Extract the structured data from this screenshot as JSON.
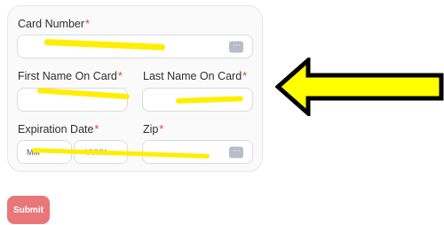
{
  "form": {
    "card_number": {
      "label": "Card Number",
      "required_mark": "*",
      "value": "",
      "placeholder": ""
    },
    "first_name": {
      "label": "First Name On Card",
      "required_mark": "*",
      "value": "",
      "placeholder": ""
    },
    "last_name": {
      "label": "Last Name On Card",
      "required_mark": "*",
      "value": "",
      "placeholder": ""
    },
    "expiration": {
      "label": "Expiration Date",
      "required_mark": "*",
      "month_placeholder": "MM",
      "year_placeholder": "YYYY"
    },
    "zip": {
      "label": "Zip",
      "required_mark": "*",
      "value": "",
      "placeholder": ""
    },
    "field_icon": "more-horizontal-icon"
  },
  "submit": {
    "label": "Submit"
  },
  "annotation": {
    "highlight_color": "#ffee00",
    "arrow_fill": "#ffff00",
    "arrow_stroke": "#000000",
    "arrow_direction": "left"
  },
  "colors": {
    "required": "#e0453f",
    "submit_bg": "#e8777a",
    "panel_bg": "#fafafa"
  }
}
